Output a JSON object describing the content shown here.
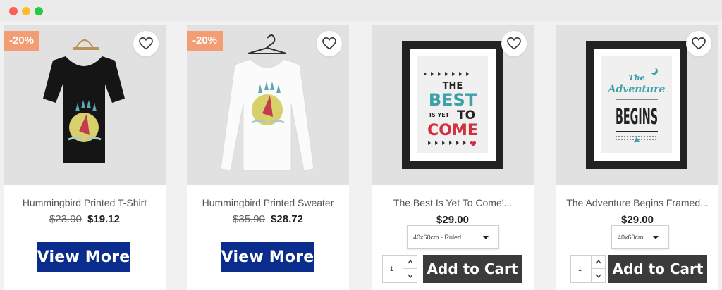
{
  "window": {
    "controls": [
      "close",
      "minimize",
      "maximize"
    ],
    "control_colors": [
      "#fd5f57",
      "#febc2e",
      "#28c840"
    ]
  },
  "accent": {
    "primary_button": "#0a2c8d",
    "cart_button": "#3b3b3b",
    "badge": "#f39d74"
  },
  "products": [
    {
      "badge": "-20%",
      "name": "Hummingbird Printed T-Shirt",
      "old_price": "$23.90",
      "price": "$19.12",
      "action_label": "View More",
      "image_icon": "black-tshirt-image"
    },
    {
      "badge": "-20%",
      "name": "Hummingbird Printed Sweater",
      "old_price": "$35.90",
      "price": "$28.72",
      "action_label": "View More",
      "image_icon": "white-sweater-image"
    },
    {
      "name": "The Best Is Yet To Come'...",
      "price": "$29.00",
      "select_value": "40x60cm - Ruled",
      "quantity": "1",
      "action_label": "Add to Cart",
      "poster_lines": [
        "THE",
        "BEST",
        "IS YET",
        "TO",
        "COME"
      ],
      "image_icon": "framed-poster-image"
    },
    {
      "name": "The Adventure Begins Framed...",
      "price": "$29.00",
      "select_value": "40x60cm",
      "quantity": "1",
      "action_label": "Add to Cart",
      "poster_lines": [
        "The",
        "Adventure",
        "BEGINS"
      ],
      "image_icon": "framed-poster-image"
    }
  ]
}
